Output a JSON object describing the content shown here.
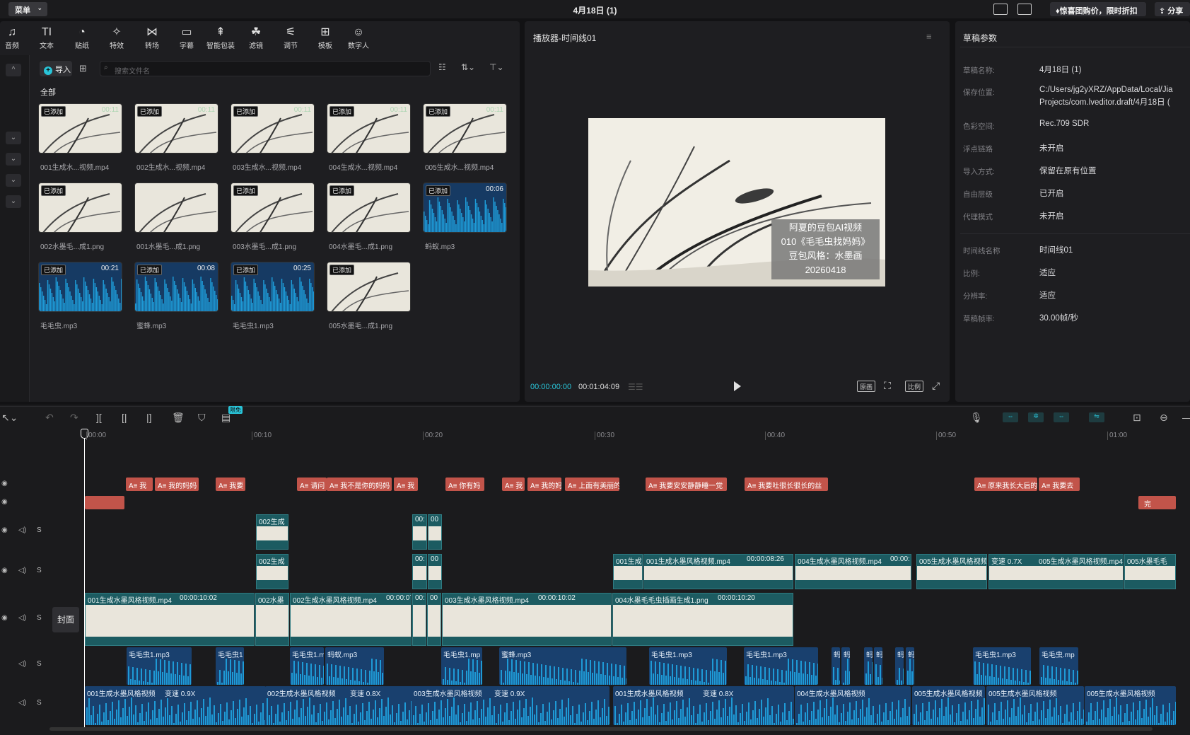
{
  "topbar": {
    "menu_label": "菜单",
    "window_title": "4月18日 (1)",
    "promo_label": "惊喜团购价，限时折扣",
    "share_label": "分享"
  },
  "toolbar": [
    {
      "icon": "audio-icon",
      "glyph": "♫",
      "label": "音频"
    },
    {
      "icon": "text-icon",
      "glyph": "TI",
      "label": "文本"
    },
    {
      "icon": "sticker-icon",
      "glyph": "◔",
      "label": "贴纸"
    },
    {
      "icon": "effects-icon",
      "glyph": "✧",
      "label": "特效"
    },
    {
      "icon": "transition-icon",
      "glyph": "⋈",
      "label": "转场"
    },
    {
      "icon": "subtitle-icon",
      "glyph": "▭",
      "label": "字幕"
    },
    {
      "icon": "smart-pack-icon",
      "glyph": "⇞",
      "label": "智能包装"
    },
    {
      "icon": "filter-icon",
      "glyph": "☘",
      "label": "滤镜"
    },
    {
      "icon": "adjust-icon",
      "glyph": "⚟",
      "label": "调节"
    },
    {
      "icon": "template-icon",
      "glyph": "⊞",
      "label": "模板"
    },
    {
      "icon": "digital-human-icon",
      "glyph": "☺",
      "label": "数字人"
    }
  ],
  "media_panel": {
    "import_label": "导入",
    "search_placeholder": "搜索文件名",
    "category": "全部",
    "items": [
      {
        "name": "001生成水...视频.mp4",
        "tag": "已添加",
        "duration": "00:11",
        "type": "video"
      },
      {
        "name": "002生成水...视频.mp4",
        "tag": "已添加",
        "duration": "00:11",
        "type": "video"
      },
      {
        "name": "003生成水...视频.mp4",
        "tag": "已添加",
        "duration": "00:11",
        "type": "video"
      },
      {
        "name": "004生成水...视频.mp4",
        "tag": "已添加",
        "duration": "00:11",
        "type": "video"
      },
      {
        "name": "005生成水...视频.mp4",
        "tag": "已添加",
        "duration": "00:11",
        "type": "video"
      },
      {
        "name": "002水墨毛...成1.png",
        "tag": "已添加",
        "duration": "",
        "type": "image"
      },
      {
        "name": "001水墨毛...成1.png",
        "tag": "",
        "duration": "",
        "type": "image"
      },
      {
        "name": "003水墨毛...成1.png",
        "tag": "已添加",
        "duration": "",
        "type": "image"
      },
      {
        "name": "004水墨毛...成1.png",
        "tag": "已添加",
        "duration": "",
        "type": "image"
      },
      {
        "name": "蚂蚁.mp3",
        "tag": "已添加",
        "duration": "00:06",
        "type": "audio"
      },
      {
        "name": "毛毛虫.mp3",
        "tag": "已添加",
        "duration": "00:21",
        "type": "audio"
      },
      {
        "name": "蜜蜂.mp3",
        "tag": "已添加",
        "duration": "00:08",
        "type": "audio"
      },
      {
        "name": "毛毛虫1.mp3",
        "tag": "已添加",
        "duration": "00:25",
        "type": "audio"
      },
      {
        "name": "005水墨毛...成1.png",
        "tag": "已添加",
        "duration": "",
        "type": "image"
      }
    ]
  },
  "player": {
    "title": "播放器-时间线01",
    "caption_lines": [
      "阿夏的豆包AI视频",
      "010《毛毛虫找妈妈》",
      "豆包风格：水墨画",
      "20260418"
    ],
    "current_time": "00:00:00:00",
    "total_time": "00:01:04:09",
    "btn_original": "原画",
    "btn_ratio": "比例"
  },
  "params": {
    "title": "草稿参数",
    "rows": [
      {
        "label": "草稿名称:",
        "value": "4月18日 (1)"
      },
      {
        "label": "保存位置:",
        "value": "C:/Users/jg2yXRZ/AppData/Local/Jia",
        "value2": "Projects/com.lveditor.draft/4月18日 ("
      },
      {
        "label": "色彩空间:",
        "value": "Rec.709 SDR"
      },
      {
        "label": "浮点链路",
        "value": "未开启"
      },
      {
        "label": "导入方式:",
        "value": "保留在原有位置"
      },
      {
        "label": "自由层级",
        "value": "已开启"
      },
      {
        "label": "代理模式",
        "value": "未开启"
      },
      {
        "label": "时间线名称",
        "value": "时间线01"
      },
      {
        "label": "比例:",
        "value": "适应"
      },
      {
        "label": "分辨率:",
        "value": "适应"
      },
      {
        "label": "草稿帧率:",
        "value": "30.00帧/秒"
      }
    ]
  },
  "timeline": {
    "free_badge": "限免",
    "cover_label": "封面",
    "ruler": [
      "00:00",
      "00:10",
      "00:20",
      "00:30",
      "00:40",
      "00:50",
      "01:00"
    ],
    "text_clips": [
      "A≡ 我",
      "A≡ 我的妈妈",
      "A≡ 我要",
      "A≡ 请问",
      "A≡ 我不是你的妈妈",
      "A≡ 我",
      "A≡ 你有妈",
      "A≡ 我",
      "A≡ 我的妈",
      "A≡ 上面有美丽的",
      "A≡ 我要安安静静睡一觉",
      "A≡ 我要吐很长很长的丝",
      "A≡ 原来我长大后的",
      "A≡ 我要去"
    ],
    "sticker_clip_right": "完",
    "video_row1": [
      "002生成",
      "00:",
      "00"
    ],
    "video_row2": [
      "002生成",
      "00:",
      "00",
      "001生成",
      "001生成水墨风格视频.mp4",
      "00:00:08:26",
      "004生成水墨风格视频.mp4",
      "00:00:",
      "005生成水墨风格视频",
      "变速 0.7X",
      "005生成水墨风格视频.mp4",
      "005水墨毛毛"
    ],
    "main_row": [
      "001生成水墨风格视频.mp4",
      "00:00:10:02",
      "002水墨",
      "002生成水墨风格视频.mp4",
      "00:00:07",
      "00:",
      "00",
      "003生成水墨风格视频.mp4",
      "00:00:10:02",
      "004水墨毛毛虫插画生成1.png",
      "00:00:10:20"
    ],
    "audio_row1": [
      "毛毛虫1.mp3",
      "毛毛虫1",
      "毛毛虫1.mp",
      "蚂蚁.mp3",
      "毛毛虫1.mp",
      "蜜蜂.mp3",
      "毛毛虫1.mp3",
      "毛毛虫1.mp3",
      "蚂",
      "蚂",
      "蚂",
      "蚂",
      "蚂",
      "蚂",
      "毛毛虫1.mp3",
      "毛毛虫.mp"
    ],
    "audio_row2": [
      "001生成水墨风格视频",
      "变速 0.9X",
      "002生成水墨风格视频",
      "变速 0.8X",
      "003生成水墨风格视频",
      "变速 0.9X",
      "001生成水墨风格视频",
      "变速 0.8X",
      "004生成水墨风格视频",
      "005生成水墨风格视频",
      "005生成水墨风格视频",
      "005生成水墨风格视频"
    ]
  },
  "colors": {
    "accent": "#29c4d8",
    "text_clip": "#c2544a",
    "video_clip": "#1c5b61",
    "audio_clip": "#19406e"
  }
}
